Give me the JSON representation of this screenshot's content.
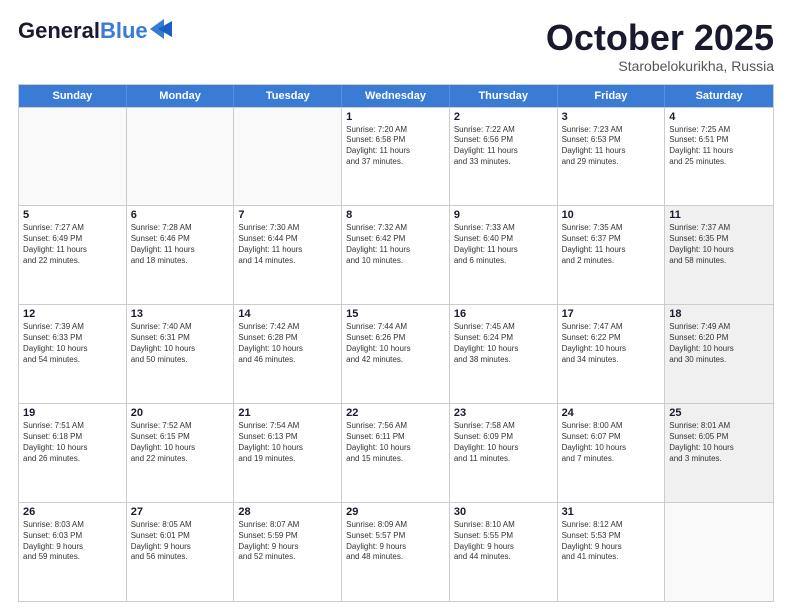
{
  "logo": {
    "line1": "General",
    "line2": "Blue"
  },
  "header": {
    "month": "October 2025",
    "location": "Starobelokurikha, Russia"
  },
  "weekdays": [
    "Sunday",
    "Monday",
    "Tuesday",
    "Wednesday",
    "Thursday",
    "Friday",
    "Saturday"
  ],
  "rows": [
    [
      {
        "day": "",
        "detail": "",
        "empty": true
      },
      {
        "day": "",
        "detail": "",
        "empty": true
      },
      {
        "day": "",
        "detail": "",
        "empty": true
      },
      {
        "day": "1",
        "detail": "Sunrise: 7:20 AM\nSunset: 6:58 PM\nDaylight: 11 hours\nand 37 minutes."
      },
      {
        "day": "2",
        "detail": "Sunrise: 7:22 AM\nSunset: 6:56 PM\nDaylight: 11 hours\nand 33 minutes."
      },
      {
        "day": "3",
        "detail": "Sunrise: 7:23 AM\nSunset: 6:53 PM\nDaylight: 11 hours\nand 29 minutes."
      },
      {
        "day": "4",
        "detail": "Sunrise: 7:25 AM\nSunset: 6:51 PM\nDaylight: 11 hours\nand 25 minutes."
      }
    ],
    [
      {
        "day": "5",
        "detail": "Sunrise: 7:27 AM\nSunset: 6:49 PM\nDaylight: 11 hours\nand 22 minutes."
      },
      {
        "day": "6",
        "detail": "Sunrise: 7:28 AM\nSunset: 6:46 PM\nDaylight: 11 hours\nand 18 minutes."
      },
      {
        "day": "7",
        "detail": "Sunrise: 7:30 AM\nSunset: 6:44 PM\nDaylight: 11 hours\nand 14 minutes."
      },
      {
        "day": "8",
        "detail": "Sunrise: 7:32 AM\nSunset: 6:42 PM\nDaylight: 11 hours\nand 10 minutes."
      },
      {
        "day": "9",
        "detail": "Sunrise: 7:33 AM\nSunset: 6:40 PM\nDaylight: 11 hours\nand 6 minutes."
      },
      {
        "day": "10",
        "detail": "Sunrise: 7:35 AM\nSunset: 6:37 PM\nDaylight: 11 hours\nand 2 minutes."
      },
      {
        "day": "11",
        "detail": "Sunrise: 7:37 AM\nSunset: 6:35 PM\nDaylight: 10 hours\nand 58 minutes.",
        "shaded": true
      }
    ],
    [
      {
        "day": "12",
        "detail": "Sunrise: 7:39 AM\nSunset: 6:33 PM\nDaylight: 10 hours\nand 54 minutes."
      },
      {
        "day": "13",
        "detail": "Sunrise: 7:40 AM\nSunset: 6:31 PM\nDaylight: 10 hours\nand 50 minutes."
      },
      {
        "day": "14",
        "detail": "Sunrise: 7:42 AM\nSunset: 6:28 PM\nDaylight: 10 hours\nand 46 minutes."
      },
      {
        "day": "15",
        "detail": "Sunrise: 7:44 AM\nSunset: 6:26 PM\nDaylight: 10 hours\nand 42 minutes."
      },
      {
        "day": "16",
        "detail": "Sunrise: 7:45 AM\nSunset: 6:24 PM\nDaylight: 10 hours\nand 38 minutes."
      },
      {
        "day": "17",
        "detail": "Sunrise: 7:47 AM\nSunset: 6:22 PM\nDaylight: 10 hours\nand 34 minutes."
      },
      {
        "day": "18",
        "detail": "Sunrise: 7:49 AM\nSunset: 6:20 PM\nDaylight: 10 hours\nand 30 minutes.",
        "shaded": true
      }
    ],
    [
      {
        "day": "19",
        "detail": "Sunrise: 7:51 AM\nSunset: 6:18 PM\nDaylight: 10 hours\nand 26 minutes."
      },
      {
        "day": "20",
        "detail": "Sunrise: 7:52 AM\nSunset: 6:15 PM\nDaylight: 10 hours\nand 22 minutes."
      },
      {
        "day": "21",
        "detail": "Sunrise: 7:54 AM\nSunset: 6:13 PM\nDaylight: 10 hours\nand 19 minutes."
      },
      {
        "day": "22",
        "detail": "Sunrise: 7:56 AM\nSunset: 6:11 PM\nDaylight: 10 hours\nand 15 minutes."
      },
      {
        "day": "23",
        "detail": "Sunrise: 7:58 AM\nSunset: 6:09 PM\nDaylight: 10 hours\nand 11 minutes."
      },
      {
        "day": "24",
        "detail": "Sunrise: 8:00 AM\nSunset: 6:07 PM\nDaylight: 10 hours\nand 7 minutes."
      },
      {
        "day": "25",
        "detail": "Sunrise: 8:01 AM\nSunset: 6:05 PM\nDaylight: 10 hours\nand 3 minutes.",
        "shaded": true
      }
    ],
    [
      {
        "day": "26",
        "detail": "Sunrise: 8:03 AM\nSunset: 6:03 PM\nDaylight: 9 hours\nand 59 minutes."
      },
      {
        "day": "27",
        "detail": "Sunrise: 8:05 AM\nSunset: 6:01 PM\nDaylight: 9 hours\nand 56 minutes."
      },
      {
        "day": "28",
        "detail": "Sunrise: 8:07 AM\nSunset: 5:59 PM\nDaylight: 9 hours\nand 52 minutes."
      },
      {
        "day": "29",
        "detail": "Sunrise: 8:09 AM\nSunset: 5:57 PM\nDaylight: 9 hours\nand 48 minutes."
      },
      {
        "day": "30",
        "detail": "Sunrise: 8:10 AM\nSunset: 5:55 PM\nDaylight: 9 hours\nand 44 minutes."
      },
      {
        "day": "31",
        "detail": "Sunrise: 8:12 AM\nSunset: 5:53 PM\nDaylight: 9 hours\nand 41 minutes."
      },
      {
        "day": "",
        "detail": "",
        "empty": true
      }
    ]
  ]
}
